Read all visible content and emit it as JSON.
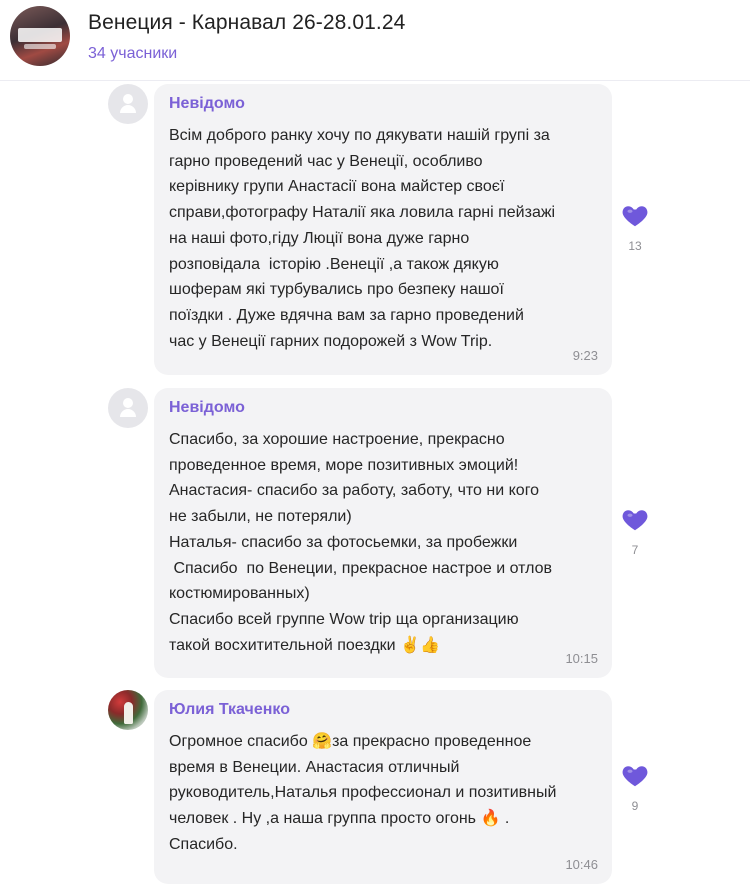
{
  "header": {
    "title": "Венеция - Карнавал 26-28.01.24",
    "members": "34 учасники"
  },
  "messages": [
    {
      "author": "Невідомо",
      "lines": [
        "Всім доброго ранку хочу по дякувати нашій групі за",
        "гарно проведений час у Венеції, особливо",
        "керівнику групи Анастасії вона майстер своєї",
        "справи,фотографу Наталії яка ловила гарні пейзажі",
        "на наші фото,гіду Люції вона дуже гарно",
        "розповідала  історію .Венеції ,а також дякую",
        "шоферам які турбувались про безпеку нашої",
        "поїздки . Дуже вдячна вам за гарно проведений",
        "час у Венеції гарних подорожей з Wow Trip."
      ],
      "time": "9:23",
      "reaction_icon": "purple-heart",
      "reaction_count": "13"
    },
    {
      "author": "Невідомо",
      "lines": [
        "Спасибо, за хорошие настроение, прекрасно",
        "проведенное время, море позитивных эмоций!",
        "Анастасия- спасибо за работу, заботу, что ни кого",
        "не забыли, не потеряли)",
        "Наталья- спасибо за фотосьемки, за пробежки",
        " Спасибо  по Венеции, прекрасное настрое и отлов",
        "костюмированных)",
        "Спасибо всей группе Wow trip ща организацию",
        "такой восхитительной поездки ✌️👍"
      ],
      "time": "10:15",
      "reaction_icon": "purple-heart",
      "reaction_count": "7"
    },
    {
      "author": "Юлия Ткаченко",
      "lines": [
        "Огромное спасибо 🤗за прекрасно проведенное",
        "время в Венеции. Анастасия отличный",
        "руководитель,Наталья профессионал и позитивный",
        "человек . Ну ,а наша группа просто огонь 🔥 .",
        "Спасибо."
      ],
      "time": "10:46",
      "reaction_icon": "purple-heart",
      "reaction_count": "9"
    }
  ],
  "colors": {
    "accent": "#7b61d6",
    "bubble": "#f3f3f5",
    "heart": "#6f58db"
  }
}
